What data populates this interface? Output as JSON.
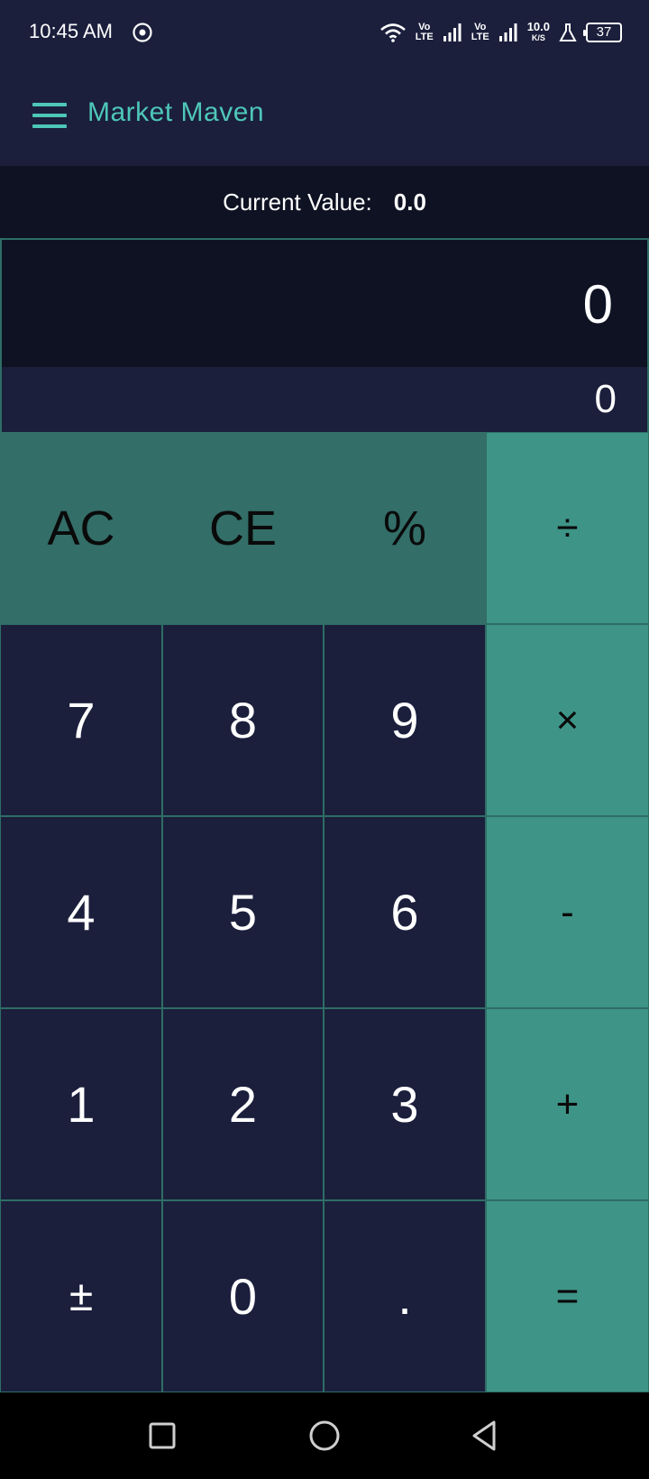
{
  "status_bar": {
    "time": "10:45 AM",
    "net1_top": "Vo",
    "net1_bottom": "LTE",
    "net2_top": "Vo",
    "net2_bottom": "LTE",
    "speed_value": "10.0",
    "speed_unit": "K/S",
    "battery": "37"
  },
  "app_bar": {
    "title": "Market Maven",
    "menu_icon": "hamburger-menu-icon"
  },
  "current_value": {
    "label": "Current Value:",
    "value": "0.0"
  },
  "display": {
    "main": "0",
    "sub": "0"
  },
  "keys": {
    "ac": "AC",
    "ce": "CE",
    "percent": "%",
    "divide": "÷",
    "seven": "7",
    "eight": "8",
    "nine": "9",
    "multiply": "×",
    "four": "4",
    "five": "5",
    "six": "6",
    "minus": "-",
    "one": "1",
    "two": "2",
    "three": "3",
    "plus": "+",
    "plus_minus": "±",
    "zero": "0",
    "decimal": ".",
    "equals": "="
  },
  "colors": {
    "background": "#1b1f3c",
    "display_bg": "#0e1223",
    "accent": "#4ec7b8",
    "function_key": "#336e68",
    "operator_key": "#3e9487",
    "grid_line": "#2e6d66"
  }
}
